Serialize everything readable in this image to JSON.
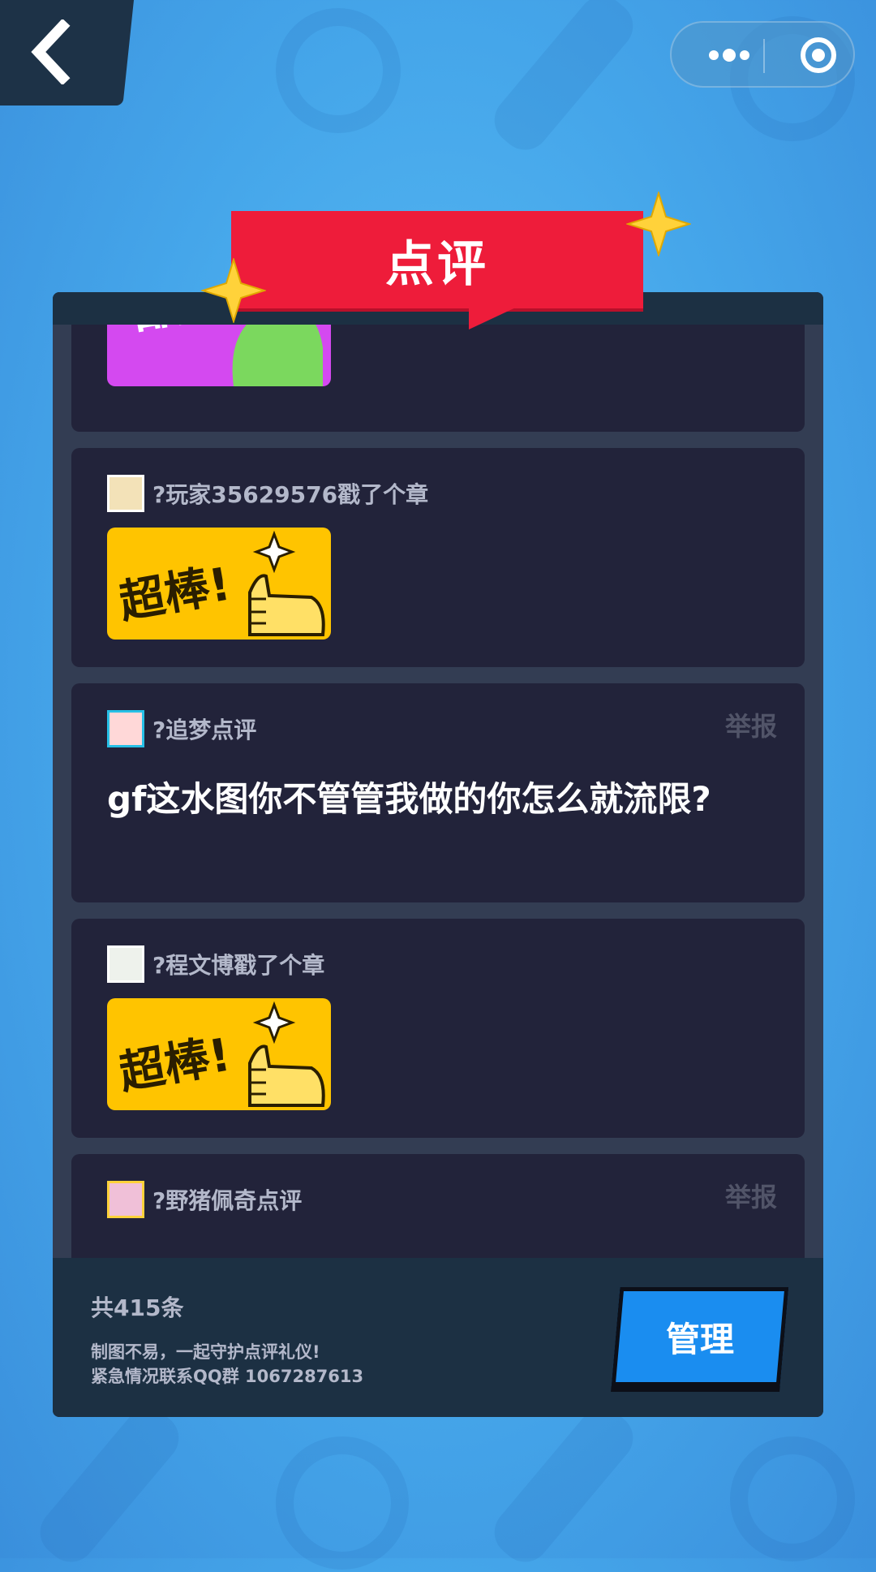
{
  "nav": {
    "back_icon": "chevron-left-icon",
    "capsule": {
      "more_icon": "more-dots-icon",
      "close_icon": "target-circle-icon"
    }
  },
  "title": "点评",
  "comments": [
    {
      "type": "sticker",
      "sticker": "酷",
      "sticker_color": "#d449f0"
    },
    {
      "type": "sticker",
      "user": "?玩家35629576戳了个章",
      "sticker": "超棒!",
      "sticker_color": "#ffc400"
    },
    {
      "type": "text",
      "user": "?追梦点评",
      "report": "举报",
      "text": "gf这水图你不管管我做的你怎么就流限?"
    },
    {
      "type": "sticker",
      "user": "?程文博戳了个章",
      "sticker": "超棒!",
      "sticker_color": "#ffc400"
    },
    {
      "type": "text",
      "user": "?野猪佩奇点评",
      "report": "举报"
    }
  ],
  "footer": {
    "count": "共415条",
    "note1": "制图不易，一起守护点评礼仪!",
    "note2": "紧急情况联系QQ群 1067287613",
    "manage": "管理"
  }
}
